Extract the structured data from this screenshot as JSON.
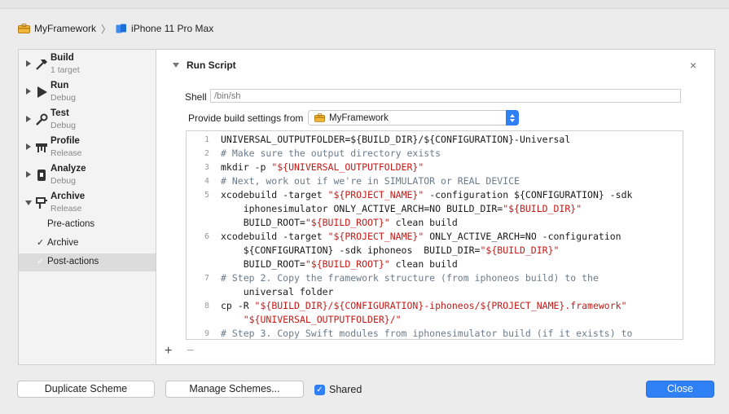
{
  "breadcrumb": {
    "project": "MyFramework",
    "separator": "〉",
    "device": "iPhone 11 Pro Max"
  },
  "sidebar": {
    "actions": [
      {
        "name": "Build",
        "sub": "1 target",
        "icon": "hammer-icon"
      },
      {
        "name": "Run",
        "sub": "Debug",
        "icon": "play-icon"
      },
      {
        "name": "Test",
        "sub": "Debug",
        "icon": "wrench-icon"
      },
      {
        "name": "Profile",
        "sub": "Release",
        "icon": "instruments-icon"
      },
      {
        "name": "Analyze",
        "sub": "Debug",
        "icon": "analyze-icon"
      },
      {
        "name": "Archive",
        "sub": "Release",
        "icon": "archive-icon"
      }
    ],
    "sub_items": [
      {
        "label": "Pre-actions",
        "check": ""
      },
      {
        "label": "Archive",
        "check": "✓"
      },
      {
        "label": "Post-actions",
        "check": "✓"
      }
    ]
  },
  "run_script": {
    "title": "Run Script",
    "close": "×",
    "shell_label": "Shell",
    "shell_placeholder": "/bin/sh",
    "provide_label": "Provide build settings from",
    "provide_value": "MyFramework"
  },
  "code_lines": [
    {
      "n": "1",
      "text": "UNIVERSAL_OUTPUTFOLDER=${BUILD_DIR}/${CONFIGURATION}-Universal"
    },
    {
      "n": "2",
      "text": "# Make sure the output directory exists"
    },
    {
      "n": "3",
      "text": "mkdir -p \"${UNIVERSAL_OUTPUTFOLDER}\""
    },
    {
      "n": "4",
      "text": "# Next, work out if we're in SIMULATOR or REAL DEVICE"
    },
    {
      "n": "5",
      "text": "xcodebuild -target \"${PROJECT_NAME}\" -configuration ${CONFIGURATION} -sdk"
    },
    {
      "n": "",
      "text": "    iphonesimulator ONLY_ACTIVE_ARCH=NO BUILD_DIR=\"${BUILD_DIR}\""
    },
    {
      "n": "",
      "text": "    BUILD_ROOT=\"${BUILD_ROOT}\" clean build"
    },
    {
      "n": "6",
      "text": "xcodebuild -target \"${PROJECT_NAME}\" ONLY_ACTIVE_ARCH=NO -configuration"
    },
    {
      "n": "",
      "text": "    ${CONFIGURATION} -sdk iphoneos  BUILD_DIR=\"${BUILD_DIR}\""
    },
    {
      "n": "",
      "text": "    BUILD_ROOT=\"${BUILD_ROOT}\" clean build"
    },
    {
      "n": "7",
      "text": "# Step 2. Copy the framework structure (from iphoneos build) to the"
    },
    {
      "n": "",
      "text": "    universal folder"
    },
    {
      "n": "8",
      "text": "cp -R \"${BUILD_DIR}/${CONFIGURATION}-iphoneos/${PROJECT_NAME}.framework\""
    },
    {
      "n": "",
      "text": "    \"${UNIVERSAL_OUTPUTFOLDER}/\""
    },
    {
      "n": "9",
      "text": "# Step 3. Copy Swift modules from iphonesimulator build (if it exists) to"
    }
  ],
  "footer": {
    "plus": "+",
    "minus": "−",
    "duplicate": "Duplicate Scheme",
    "manage": "Manage Schemes...",
    "shared": "Shared",
    "shared_check": "✓",
    "close": "Close"
  },
  "colors": {
    "accent": "#2f7ff5",
    "string": "#c41a16",
    "comment": "#6b7b8a"
  }
}
